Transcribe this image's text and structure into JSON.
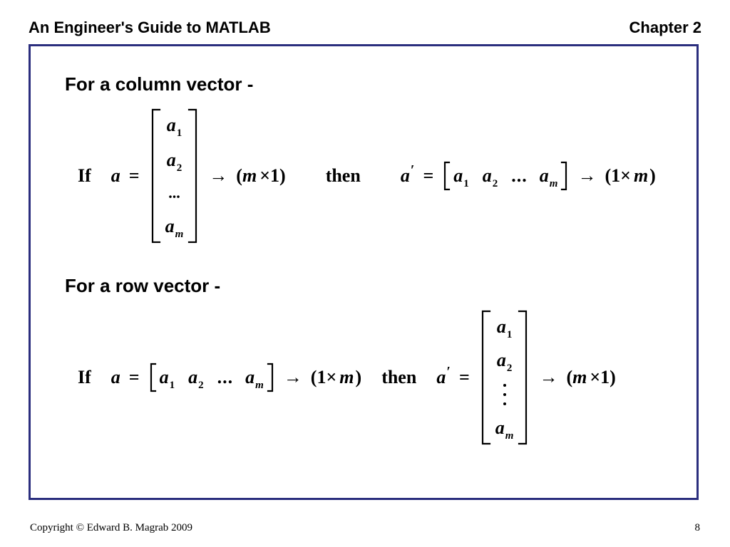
{
  "header": {
    "title": "An Engineer's Guide to MATLAB",
    "chapter": "Chapter 2"
  },
  "section1": {
    "title": "For a column vector -",
    "if_label": "If",
    "then_label": "then",
    "dims_col": "(m × 1)",
    "dims_row": "(1 × m)"
  },
  "section2": {
    "title": "For a row vector -",
    "if_label": "If",
    "then_label": "then",
    "dims_col": "(m × 1)",
    "dims_row": "(1 × m)"
  },
  "symbols": {
    "a": "a",
    "eq": "=",
    "arrow": "→",
    "times": "×",
    "lparen": "(",
    "rparen": ")",
    "one": "1",
    "m": "m",
    "dots": "...",
    "prime": "′"
  },
  "vector": {
    "e1_sub": "1",
    "e2_sub": "2",
    "em_sub": "m"
  },
  "footer": {
    "copyright": "Copyright © Edward B. Magrab 2009",
    "page": "8"
  }
}
